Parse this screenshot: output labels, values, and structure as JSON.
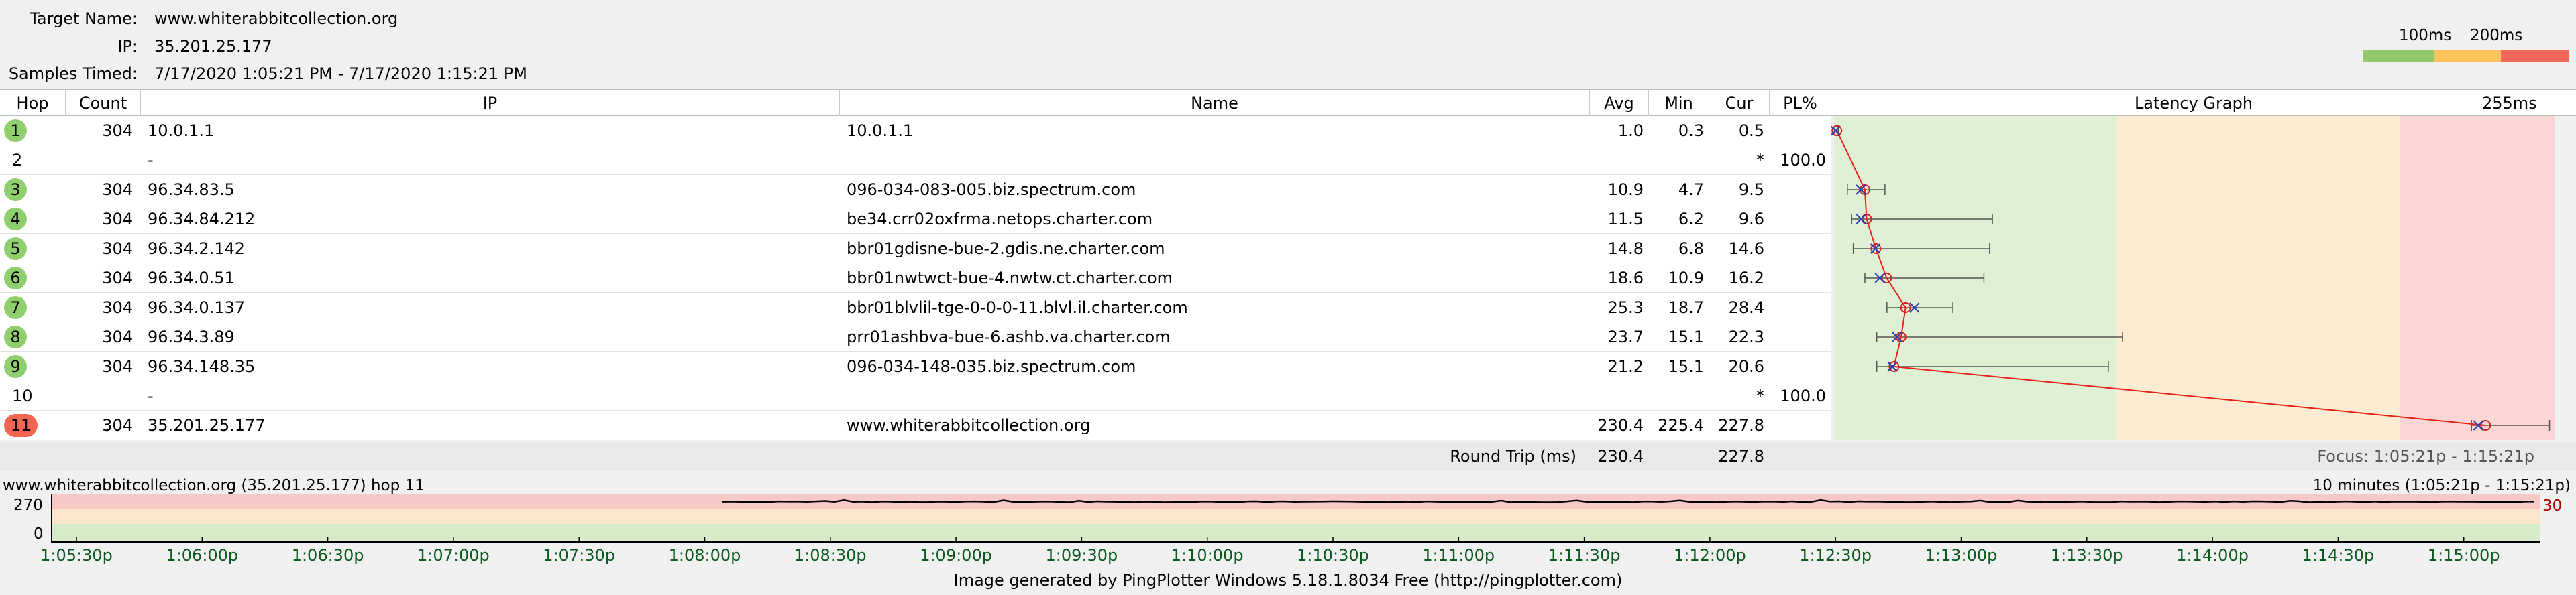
{
  "summary": {
    "target_label": "Target Name:",
    "target_value": "www.whiterabbitcollection.org",
    "ip_label": "IP:",
    "ip_value": "35.201.25.177",
    "samples_label": "Samples Timed:",
    "samples_value": "7/17/2020 1:05:21 PM - 7/17/2020 1:15:21 PM"
  },
  "legend": {
    "label_100": "100ms",
    "label_200": "200ms",
    "colors": [
      "#92c96e",
      "#fbc45c",
      "#f2665a"
    ]
  },
  "table": {
    "headers": {
      "hop": "Hop",
      "count": "Count",
      "ip": "IP",
      "name": "Name",
      "avg": "Avg",
      "min": "Min",
      "cur": "Cur",
      "pl": "PL%",
      "graph": "Latency Graph",
      "scale": "255ms"
    },
    "rows": [
      {
        "hop": "1",
        "count": "304",
        "ip": "10.0.1.1",
        "name": "10.0.1.1",
        "avg": "1.0",
        "min": "0.3",
        "cur": "0.5",
        "pl": "",
        "status": "good"
      },
      {
        "hop": "2",
        "count": "",
        "ip": "-",
        "name": "",
        "avg": "",
        "min": "",
        "cur": "*",
        "pl": "100.0",
        "status": "none"
      },
      {
        "hop": "3",
        "count": "304",
        "ip": "96.34.83.5",
        "name": "096-034-083-005.biz.spectrum.com",
        "avg": "10.9",
        "min": "4.7",
        "cur": "9.5",
        "pl": "",
        "status": "good"
      },
      {
        "hop": "4",
        "count": "304",
        "ip": "96.34.84.212",
        "name": "be34.crr02oxfrma.netops.charter.com",
        "avg": "11.5",
        "min": "6.2",
        "cur": "9.6",
        "pl": "",
        "status": "good"
      },
      {
        "hop": "5",
        "count": "304",
        "ip": "96.34.2.142",
        "name": "bbr01gdisne-bue-2.gdis.ne.charter.com",
        "avg": "14.8",
        "min": "6.8",
        "cur": "14.6",
        "pl": "",
        "status": "good"
      },
      {
        "hop": "6",
        "count": "304",
        "ip": "96.34.0.51",
        "name": "bbr01nwtwct-bue-4.nwtw.ct.charter.com",
        "avg": "18.6",
        "min": "10.9",
        "cur": "16.2",
        "pl": "",
        "status": "good"
      },
      {
        "hop": "7",
        "count": "304",
        "ip": "96.34.0.137",
        "name": "bbr01blvlil-tge-0-0-0-11.blvl.il.charter.com",
        "avg": "25.3",
        "min": "18.7",
        "cur": "28.4",
        "pl": "",
        "status": "good"
      },
      {
        "hop": "8",
        "count": "304",
        "ip": "96.34.3.89",
        "name": "prr01ashbva-bue-6.ashb.va.charter.com",
        "avg": "23.7",
        "min": "15.1",
        "cur": "22.3",
        "pl": "",
        "status": "good"
      },
      {
        "hop": "9",
        "count": "304",
        "ip": "96.34.148.35",
        "name": "096-034-148-035.biz.spectrum.com",
        "avg": "21.2",
        "min": "15.1",
        "cur": "20.6",
        "pl": "",
        "status": "good"
      },
      {
        "hop": "10",
        "count": "",
        "ip": "-",
        "name": "",
        "avg": "",
        "min": "",
        "cur": "*",
        "pl": "100.0",
        "status": "none"
      },
      {
        "hop": "11",
        "count": "304",
        "ip": "35.201.25.177",
        "name": "www.whiterabbitcollection.org",
        "avg": "230.4",
        "min": "225.4",
        "cur": "227.8",
        "pl": "",
        "status": "bad"
      }
    ],
    "round_trip_label": "Round Trip (ms)",
    "round_trip_avg": "230.4",
    "round_trip_cur": "227.8",
    "focus": "Focus: 1:05:21p - 1:15:21p"
  },
  "latency_graph": {
    "max_ms": 255,
    "zones_ms": [
      100,
      200
    ],
    "zone_colors": [
      "#dff0d4",
      "#fdebd2",
      "#fcd6d5"
    ],
    "hops": [
      {
        "avg": 1.0,
        "min": 0.3,
        "max": 1.5,
        "cur": 0.5
      },
      null,
      {
        "avg": 10.9,
        "min": 4.7,
        "max": 18,
        "cur": 9.5
      },
      {
        "avg": 11.5,
        "min": 6.2,
        "max": 56,
        "cur": 9.6
      },
      {
        "avg": 14.8,
        "min": 6.8,
        "max": 55,
        "cur": 14.6
      },
      {
        "avg": 18.6,
        "min": 10.9,
        "max": 53,
        "cur": 16.2
      },
      {
        "avg": 25.3,
        "min": 18.7,
        "max": 42,
        "cur": 28.4
      },
      {
        "avg": 23.7,
        "min": 15.1,
        "max": 102,
        "cur": 22.3
      },
      {
        "avg": 21.2,
        "min": 15.1,
        "max": 97,
        "cur": 20.6
      },
      null,
      {
        "avg": 230.4,
        "min": 225.4,
        "max": 253,
        "cur": 227.8
      }
    ]
  },
  "timeline": {
    "title": "www.whiterabbitcollection.org (35.201.25.177) hop 11",
    "range": "10 minutes (1:05:21p - 1:15:21p)",
    "y_top": "270",
    "y_bottom": "0",
    "right_value": "30",
    "ticks": [
      "1:05:30p",
      "1:06:00p",
      "1:06:30p",
      "1:07:00p",
      "1:07:30p",
      "1:08:00p",
      "1:08:30p",
      "1:09:00p",
      "1:09:30p",
      "1:10:00p",
      "1:10:30p",
      "1:11:00p",
      "1:11:30p",
      "1:12:00p",
      "1:12:30p",
      "1:13:00p",
      "1:13:30p",
      "1:14:00p",
      "1:14:30p",
      "1:15:00p"
    ]
  },
  "footer": "Image generated by PingPlotter Windows 5.18.1.8034 Free (http://pingplotter.com)"
}
